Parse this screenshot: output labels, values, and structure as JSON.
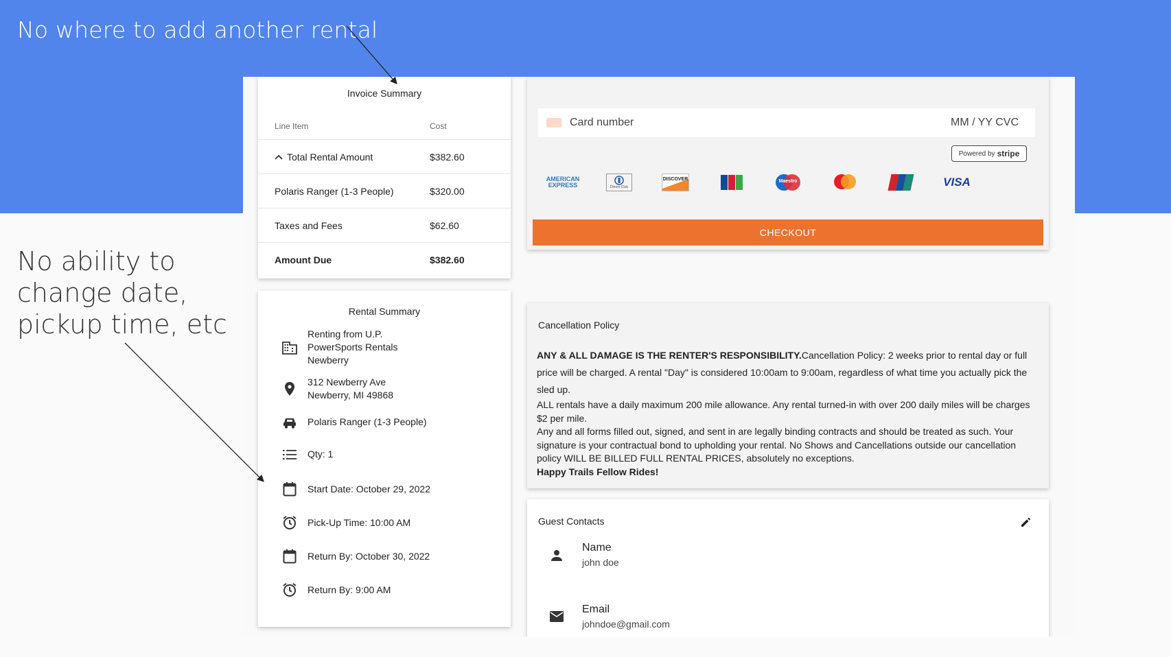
{
  "annotations": {
    "top": "No where to add another rental",
    "left": "No ability to change date, pickup time, etc"
  },
  "invoice": {
    "title": "Invoice Summary",
    "headers": {
      "item": "Line Item",
      "cost": "Cost"
    },
    "total_rental": {
      "label": "Total Rental Amount",
      "cost": "$382.60"
    },
    "rows": [
      {
        "label": "Polaris Ranger (1-3 People)",
        "cost": "$320.00"
      },
      {
        "label": "Taxes and Fees",
        "cost": "$62.60"
      }
    ],
    "amount_due": {
      "label": "Amount Due",
      "cost": "$382.60"
    }
  },
  "rental": {
    "title": "Rental Summary",
    "renting_from": "Renting from U.P. PowerSports Rentals Newberry",
    "address_line1": "312 Newberry Ave",
    "address_line2": "Newberry, MI 49868",
    "vehicle": "Polaris Ranger (1-3 People)",
    "qty": "Qty: 1",
    "start_date": "Start Date: October 29, 2022",
    "pickup_time": "Pick-Up Time: 10:00 AM",
    "return_date": "Return By: October 30, 2022",
    "return_time": "Return By: 9:00 AM"
  },
  "payment": {
    "card_placeholder": "Card number",
    "card_right": "MM / YY  CVC",
    "powered_by": "Powered by",
    "stripe": "stripe",
    "brands": [
      "AMERICAN EXPRESS",
      "Diners Club",
      "DISCOVER",
      "JCB",
      "Maestro",
      "mastercard",
      "UnionPay",
      "VISA"
    ],
    "checkout_label": "CHECKOUT"
  },
  "cancellation": {
    "title": "Cancellation Policy",
    "bold_intro": "ANY & ALL DAMAGE IS THE RENTER'S RESPONSIBILITY.",
    "para1": "Cancellation Policy: 2 weeks prior to rental day or full price will be charged. A rental \"Day\" is considered 10:00am to 9:00am, regardless of what time you actually pick the sled up.",
    "para2": "ALL rentals have a daily maximum 200 mile allowance. Any rental turned-in with over 200 daily miles will be charges $2 per mile.",
    "para3": "Any and all forms filled out, signed, and sent in are legally binding contracts and should be treated as such. Your signature is your contractual bond to upholding your rental. No Shows and Cancellations outside our cancellation policy WILL BE BILLED FULL RENTAL PRICES, absolutely no exceptions.",
    "closing": "Happy Trails Fellow Rides!"
  },
  "guest": {
    "title": "Guest Contacts",
    "name_label": "Name",
    "name_value": "john doe",
    "email_label": "Email",
    "email_value": "johndoe@gmail.com"
  },
  "colors": {
    "slide_blue": "#5185ec",
    "checkout_orange": "#ec722e"
  }
}
